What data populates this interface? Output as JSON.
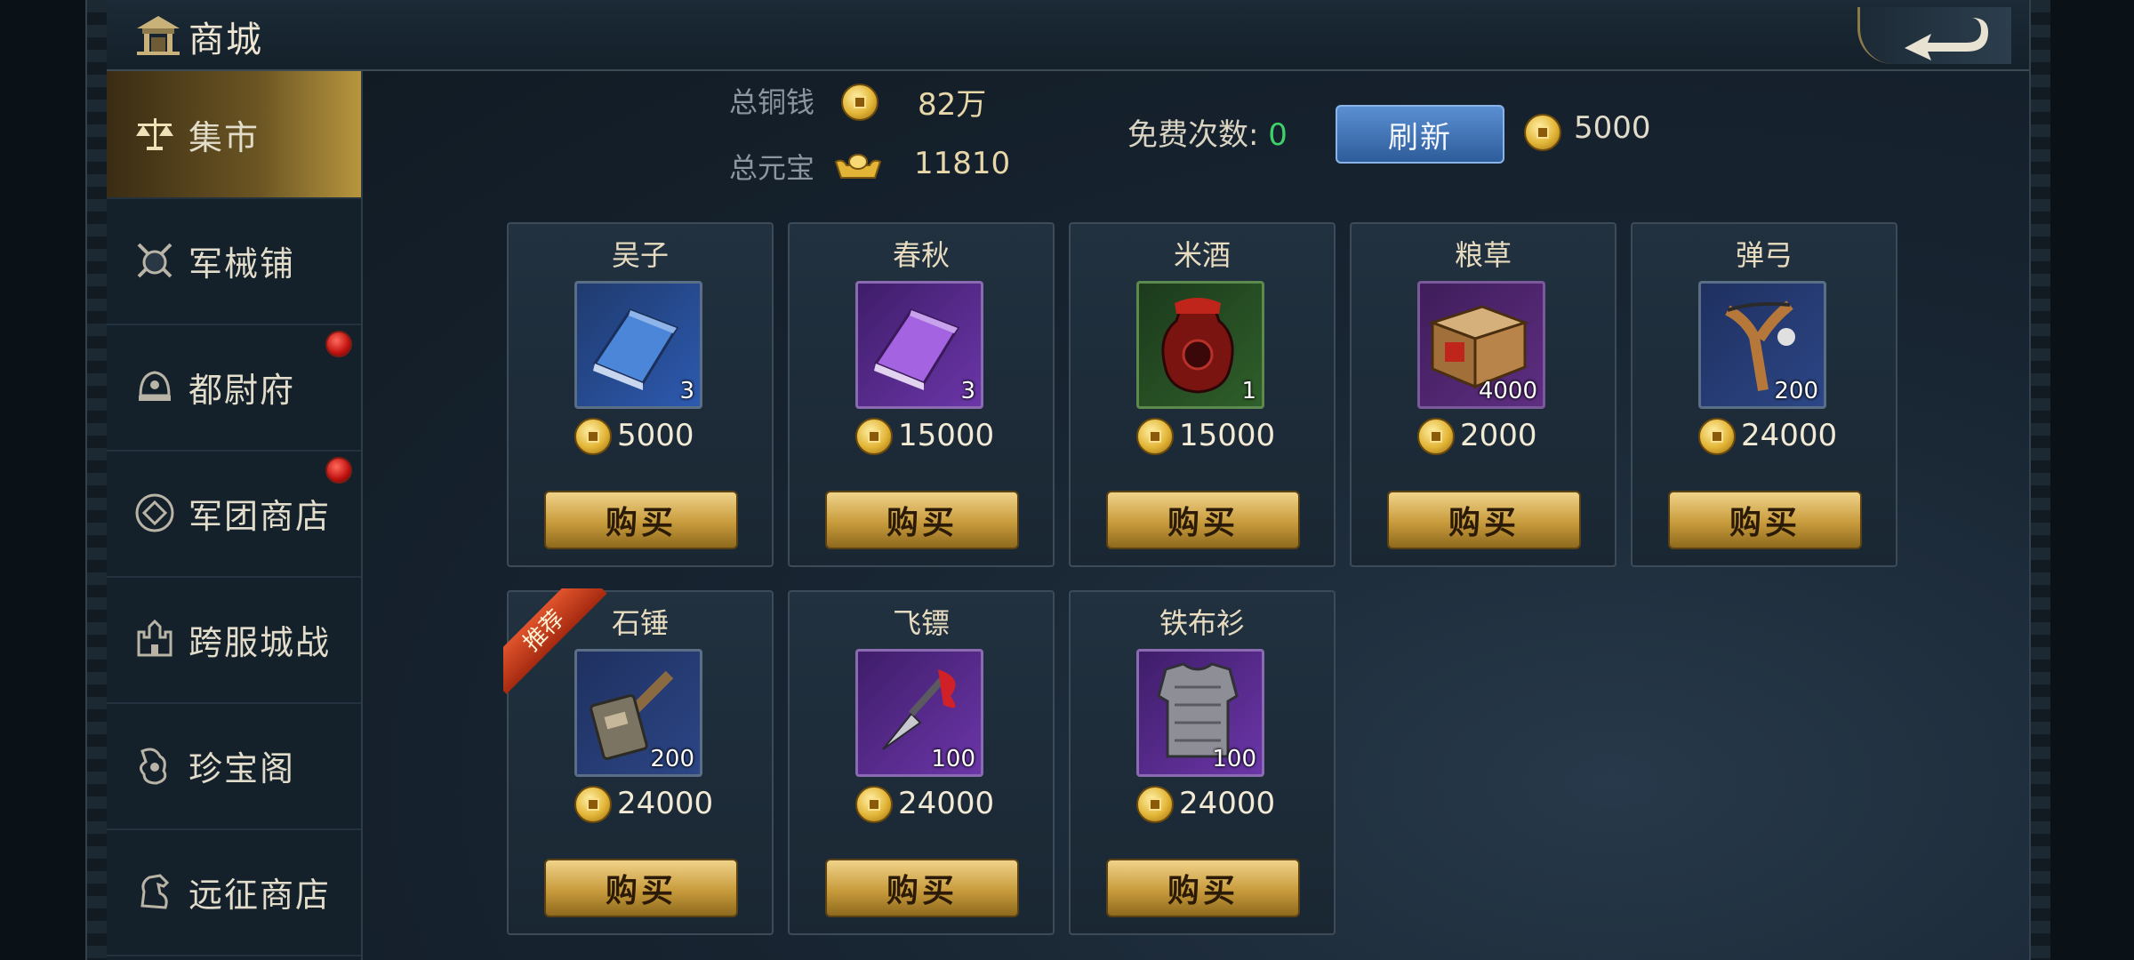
{
  "header": {
    "title": "商城"
  },
  "sidebar": {
    "items": [
      {
        "label": "集市",
        "icon": "scales-icon",
        "active": true,
        "badge": false
      },
      {
        "label": "军械铺",
        "icon": "crossed-swords-shield-icon",
        "active": false,
        "badge": false
      },
      {
        "label": "都尉府",
        "icon": "helmet-icon",
        "active": false,
        "badge": true
      },
      {
        "label": "军团商店",
        "icon": "coin-emblem-icon",
        "active": false,
        "badge": true
      },
      {
        "label": "跨服城战",
        "icon": "castle-icon",
        "active": false,
        "badge": false
      },
      {
        "label": "珍宝阁",
        "icon": "treasure-icon",
        "active": false,
        "badge": false
      },
      {
        "label": "远征商店",
        "icon": "horse-icon",
        "active": false,
        "badge": false
      }
    ]
  },
  "stats": {
    "copper_label": "总铜钱",
    "copper_value": "82万",
    "ingot_label": "总元宝",
    "ingot_value": "11810",
    "free_label": "免费次数:",
    "free_value": "0",
    "refresh_label": "刷新",
    "refresh_cost": "5000"
  },
  "shop": {
    "buy_label": "购买",
    "recommend_label": "推荐",
    "items": [
      {
        "name": "吴子",
        "count": "3",
        "price": "5000",
        "icon": "blue-book-icon"
      },
      {
        "name": "春秋",
        "count": "3",
        "price": "15000",
        "icon": "purple-book-icon"
      },
      {
        "name": "米酒",
        "count": "1",
        "price": "15000",
        "icon": "wine-jar-icon"
      },
      {
        "name": "粮草",
        "count": "4000",
        "price": "2000",
        "icon": "grain-crate-icon"
      },
      {
        "name": "弹弓",
        "count": "200",
        "price": "24000",
        "icon": "slingshot-icon"
      },
      {
        "name": "石锤",
        "count": "200",
        "price": "24000",
        "icon": "stone-hammer-icon",
        "recommended": true
      },
      {
        "name": "飞镖",
        "count": "100",
        "price": "24000",
        "icon": "dart-icon"
      },
      {
        "name": "铁布衫",
        "count": "100",
        "price": "24000",
        "icon": "chain-vest-icon"
      }
    ]
  },
  "colors": {
    "gold": "#c89b3c",
    "free_count": "#3fd06a",
    "refresh_blue": "#2e5c9a",
    "badge_red": "#c1120f"
  }
}
